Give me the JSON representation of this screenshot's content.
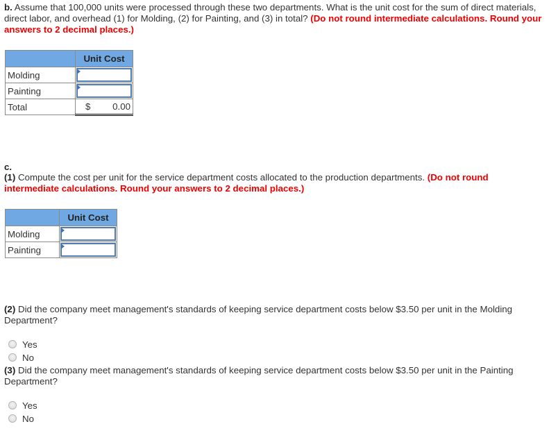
{
  "part_b": {
    "prefix": "b.",
    "text": " Assume that 100,000 units were processed through these two departments. What is the unit cost for the sum of direct materials, direct labor, and overhead (1) for Molding, (2) for Painting, and (3) in total? ",
    "instruction": "(Do not round intermediate calculations. Round your answers to 2 decimal places.)",
    "table": {
      "header": "Unit Cost",
      "rows": [
        {
          "label": "Molding",
          "value": ""
        },
        {
          "label": "Painting",
          "value": ""
        },
        {
          "label": "Total",
          "currency": "$",
          "value": "0.00"
        }
      ]
    }
  },
  "part_c": {
    "prefix": "c.",
    "q1": {
      "number": "(1)",
      "text": " Compute the cost per unit for the service department costs allocated to the production departments. ",
      "instruction": "(Do not round intermediate calculations. Round your answers to 2 decimal places.)",
      "table": {
        "header": "Unit Cost",
        "rows": [
          {
            "label": "Molding",
            "value": ""
          },
          {
            "label": "Painting",
            "value": ""
          }
        ]
      }
    },
    "q2": {
      "number": "(2)",
      "text": " Did the company meet management's standards of keeping service department costs below $3.50 per unit in the Molding Department?",
      "options": [
        "Yes",
        "No"
      ]
    },
    "q3": {
      "number": "(3)",
      "text": " Did the company meet management's standards of keeping service department costs below $3.50 per unit in the Painting Department?",
      "options": [
        "Yes",
        "No"
      ]
    }
  }
}
